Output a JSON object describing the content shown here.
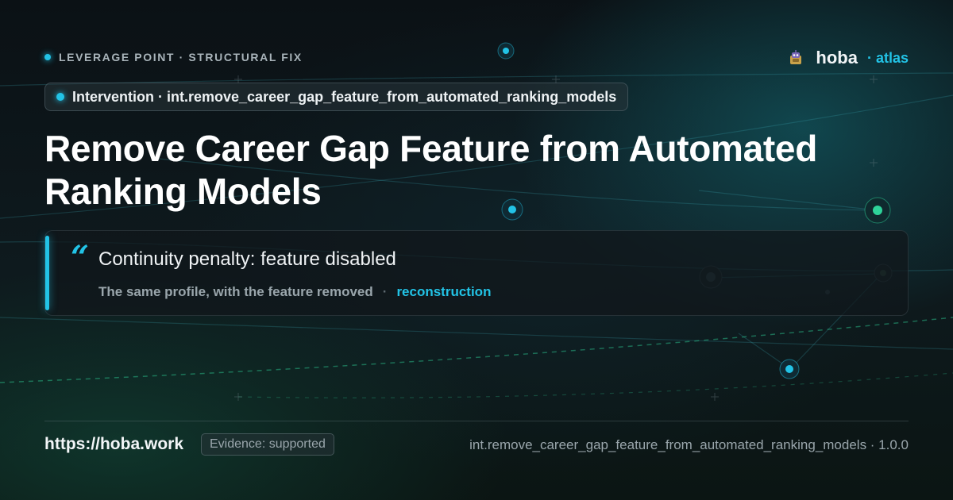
{
  "kicker": {
    "label": "LEVERAGE POINT · STRUCTURAL FIX"
  },
  "brand": {
    "name": "hoba",
    "sub": "· atlas",
    "logo_icon": "robot-logo-icon"
  },
  "pill": {
    "label": "Intervention · int.remove_career_gap_feature_from_automated_ranking_models"
  },
  "title": "Remove Career Gap Feature from Automated Ranking Models",
  "quote": {
    "mark": "“",
    "text": "Continuity penalty: feature disabled",
    "caption": "The same profile, with the feature removed",
    "separator": "·",
    "tag": "reconstruction"
  },
  "footer": {
    "url": "https://hoba.work",
    "evidence": "Evidence: supported",
    "id_version": "int.remove_career_gap_feature_from_automated_ranking_models · 1.0.0"
  },
  "colors": {
    "accent": "#22c3e6",
    "accent_green": "#2ed39a",
    "background": "#0c1216"
  }
}
